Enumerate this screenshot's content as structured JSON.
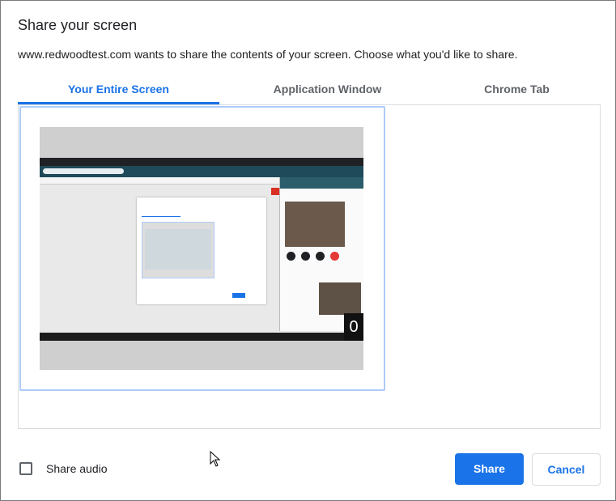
{
  "dialog": {
    "title": "Share your screen",
    "description": "www.redwoodtest.com wants to share the contents of your screen. Choose what you'd like to share."
  },
  "tabs": [
    {
      "label": "Your Entire Screen",
      "active": true
    },
    {
      "label": "Application Window",
      "active": false
    },
    {
      "label": "Chrome Tab",
      "active": false
    }
  ],
  "preview": {
    "overlay_text": "0"
  },
  "audio": {
    "label": "Share audio",
    "checked": false
  },
  "buttons": {
    "share_label": "Share",
    "cancel_label": "Cancel"
  },
  "colors": {
    "accent": "#1a73e8",
    "selection_border": "#aecbfa"
  }
}
